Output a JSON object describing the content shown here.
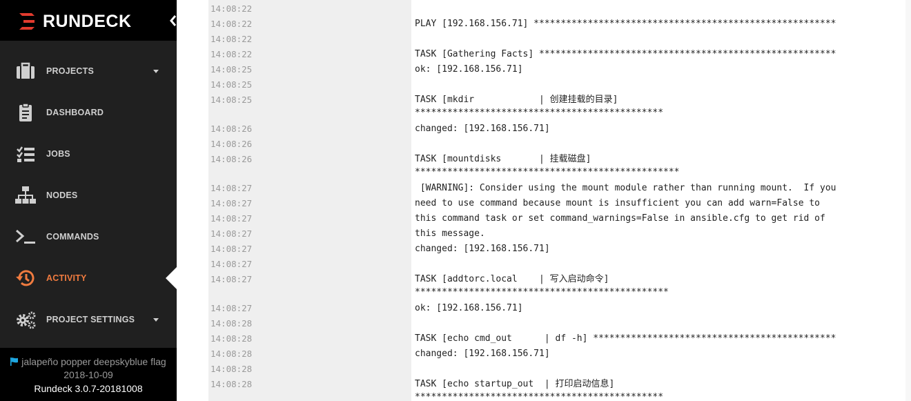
{
  "app": {
    "brand": "RUNDECK"
  },
  "colors": {
    "accent": "#f07b3f",
    "sidebar_bg": "#202020",
    "brand_bg": "#000000",
    "logo_red": "#e23b2e",
    "flag_blue": "#1ea7e1"
  },
  "nav": {
    "items": [
      {
        "label": "PROJECTS",
        "icon": "briefcase-icon",
        "has_caret": true
      },
      {
        "label": "DASHBOARD",
        "icon": "clipboard-icon"
      },
      {
        "label": "JOBS",
        "icon": "tasks-icon"
      },
      {
        "label": "NODES",
        "icon": "sitemap-icon"
      },
      {
        "label": "COMMANDS",
        "icon": "terminal-icon"
      },
      {
        "label": "ACTIVITY",
        "icon": "history-icon",
        "active": true
      },
      {
        "label": "PROJECT SETTINGS",
        "icon": "cogs-icon",
        "has_caret": true
      }
    ]
  },
  "footer": {
    "server_name": "jalapeño popper deepskyblue flag",
    "date": "2018-10-09",
    "version": "Rundeck 3.0.7-20181008"
  },
  "log": {
    "timestamps": [
      "14:08:22",
      "14:08:22",
      "14:08:22",
      "14:08:22",
      "14:08:25",
      "14:08:25",
      "14:08:25",
      "14:08:26",
      "14:08:26",
      "14:08:26",
      "14:08:27",
      "14:08:27",
      "14:08:27",
      "14:08:27",
      "14:08:27",
      "14:08:27",
      "14:08:27",
      "14:08:27",
      "14:08:28",
      "14:08:28",
      "14:08:28",
      "14:08:28",
      "14:08:28"
    ],
    "lines": {
      "play": "PLAY [192.168.156.71] ********************************************************",
      "gather": "TASK [Gathering Facts] *******************************************************",
      "gather_ok": "ok: [192.168.156.71]",
      "mkdir": "TASK [mkdir            | 创建挂载的目录]",
      "mkdir_stars": "**********************************************",
      "mkdir_changed": "changed: [192.168.156.71]",
      "mount": "TASK [mountdisks       | 挂载磁盘]",
      "mount_stars": "*************************************************",
      "warn1": " [WARNING]: Consider using the mount module rather than running mount.  If you",
      "warn2": "need to use command because mount is insufficient you can add warn=False to",
      "warn3": "this command task or set command_warnings=False in ansible.cfg to get rid of",
      "warn4": "this message.",
      "mount_changed": "changed: [192.168.156.71]",
      "addtorc": "TASK [addtorc.local    | 写入启动命令]",
      "addtorc_stars": "***********************************************",
      "addtorc_ok": "ok: [192.168.156.71]",
      "echo_cmd": "TASK [echo cmd_out      | df -h] *********************************************",
      "echo_cmd_changed": "changed: [192.168.156.71]",
      "echo_startup": "TASK [echo startup_out  | 打印启动信息]",
      "echo_startup_stars": "**********************************************"
    }
  }
}
